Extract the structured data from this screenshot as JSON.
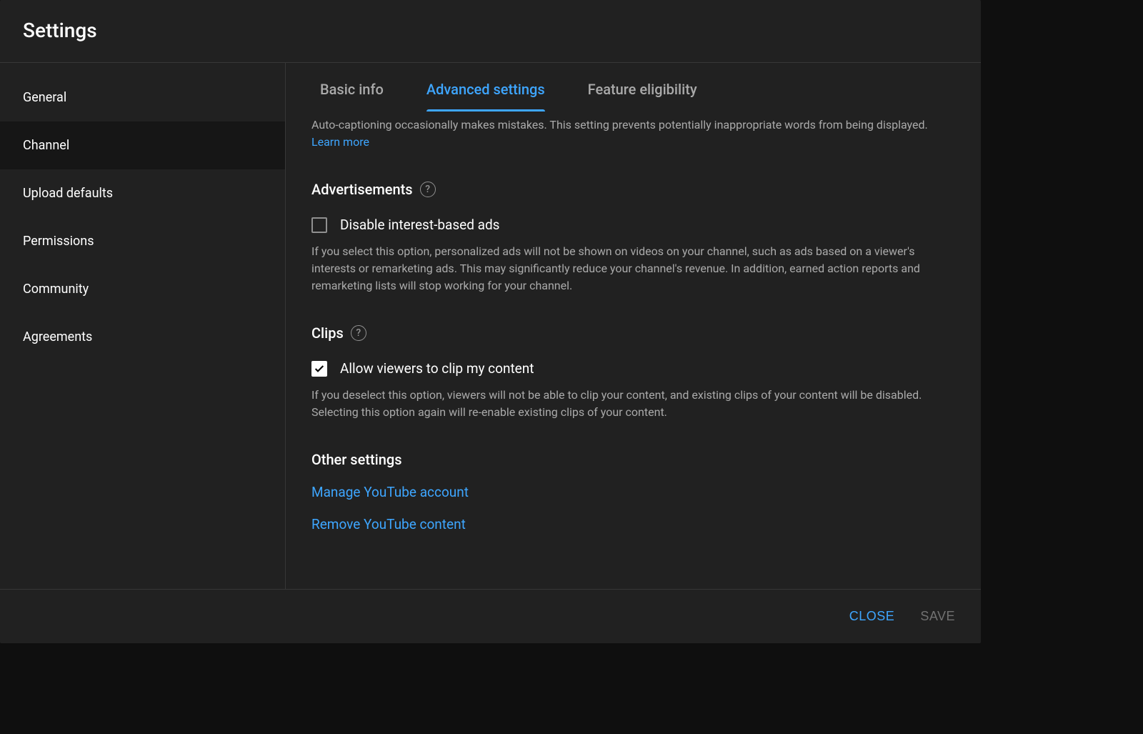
{
  "dialog": {
    "title": "Settings"
  },
  "sidebar": {
    "items": [
      {
        "label": "General"
      },
      {
        "label": "Channel"
      },
      {
        "label": "Upload defaults"
      },
      {
        "label": "Permissions"
      },
      {
        "label": "Community"
      },
      {
        "label": "Agreements"
      }
    ],
    "selected_index": 1
  },
  "tabs": {
    "items": [
      {
        "label": "Basic info"
      },
      {
        "label": "Advanced settings"
      },
      {
        "label": "Feature eligibility"
      }
    ],
    "active_index": 1
  },
  "autocaption": {
    "desc_prefix": "Auto-captioning occasionally makes mistakes. This setting prevents potentially inappropriate words from being displayed. ",
    "learn_more": "Learn more"
  },
  "ads": {
    "title": "Advertisements",
    "checkbox_label": "Disable interest-based ads",
    "checked": false,
    "desc": "If you select this option, personalized ads will not be shown on videos on your channel, such as ads based on a viewer's interests or remarketing ads. This may significantly reduce your channel's revenue. In addition, earned action reports and remarketing lists will stop working for your channel."
  },
  "clips": {
    "title": "Clips",
    "checkbox_label": "Allow viewers to clip my content",
    "checked": true,
    "desc": "If you deselect this option, viewers will not be able to clip your content, and existing clips of your content will be disabled. Selecting this option again will re-enable existing clips of your content."
  },
  "other": {
    "title": "Other settings",
    "links": [
      {
        "label": "Manage YouTube account"
      },
      {
        "label": "Remove YouTube content"
      }
    ]
  },
  "footer": {
    "close": "Close",
    "save": "Save"
  },
  "help_glyph": "?"
}
